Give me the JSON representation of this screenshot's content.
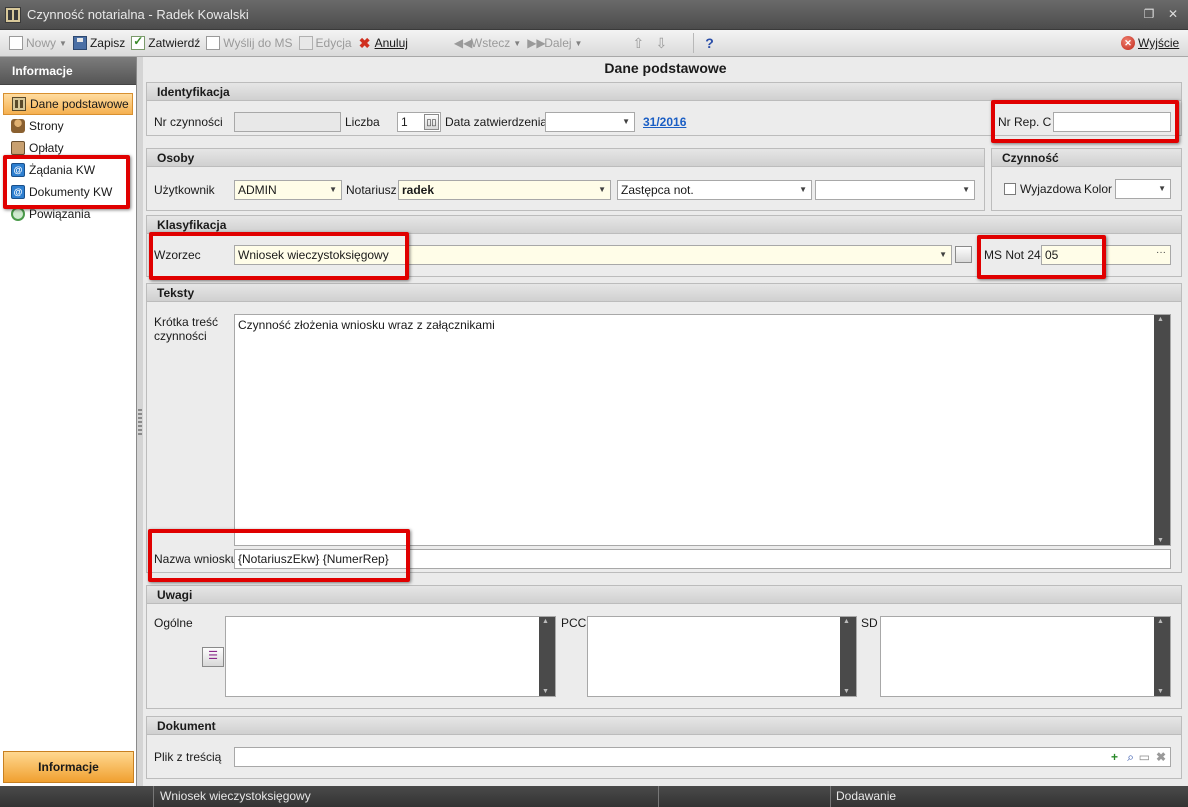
{
  "window": {
    "title": "Czynność notarialna - Radek Kowalski",
    "restore_glyph": "❐",
    "close_glyph": "✕"
  },
  "toolbar": {
    "new_label": "Nowy",
    "save_label": "Zapisz",
    "approve_label": "Zatwierdź",
    "send_ms_label": "Wyślij do MS",
    "edit_label": "Edycja",
    "cancel_label": "Anuluj",
    "back_label": "Wstecz",
    "next_label": "Dalej",
    "help_label": "?",
    "exit_label": "Wyjście"
  },
  "sidebar": {
    "header": "Informacje",
    "items": [
      {
        "label": "Dane podstawowe",
        "icon": "book-icon"
      },
      {
        "label": "Strony",
        "icon": "person-icon"
      },
      {
        "label": "Opłaty",
        "icon": "coins-icon"
      },
      {
        "label": "Żądania KW",
        "icon": "kw-icon"
      },
      {
        "label": "Dokumenty KW",
        "icon": "kw-icon"
      },
      {
        "label": "Powiązania",
        "icon": "link-icon"
      }
    ],
    "footer": "Informacje"
  },
  "main": {
    "title": "Dane podstawowe",
    "identyfikacja": {
      "header": "Identyfikacja",
      "nr_czynnosci_label": "Nr czynności",
      "nr_czynnosci_value": "",
      "liczba_label": "Liczba",
      "liczba_value": "1",
      "data_label": "Data zatwierdzenia",
      "data_value": "",
      "rep_link": "31/2016",
      "nr_rep_label": "Nr Rep. C",
      "nr_rep_value": ""
    },
    "osoby": {
      "header": "Osoby",
      "uzytkownik_label": "Użytkownik",
      "uzytkownik_value": "ADMIN",
      "notariusz_label": "Notariusz",
      "notariusz_value": "radek",
      "zastepca_value": "Zastępca not.",
      "extra_value": ""
    },
    "czynnosc": {
      "header": "Czynność",
      "wyjazdowa_label": "Wyjazdowa",
      "kolor_label": "Kolor"
    },
    "klasyfikacja": {
      "header": "Klasyfikacja",
      "wzorzec_label": "Wzorzec",
      "wzorzec_value": "Wniosek wieczystoksięgowy",
      "ms_label": "MS Not 24",
      "ms_value": "05"
    },
    "teksty": {
      "header": "Teksty",
      "krotka_label_1": "Krótka treść",
      "krotka_label_2": "czynności",
      "krotka_value": "Czynność złożenia wniosku wraz z załącznikami",
      "nazwa_label": "Nazwa wniosku",
      "nazwa_value": "{NotariuszEkw} {NumerRep}"
    },
    "uwagi": {
      "header": "Uwagi",
      "ogolne_label": "Ogólne",
      "pcc_label": "PCC",
      "sd_label": "SD"
    },
    "dokument": {
      "header": "Dokument",
      "plik_label": "Plik z treścią",
      "plik_value": ""
    }
  },
  "status": {
    "left": "Wniosek wieczystoksięgowy",
    "right": "Dodawanie"
  }
}
